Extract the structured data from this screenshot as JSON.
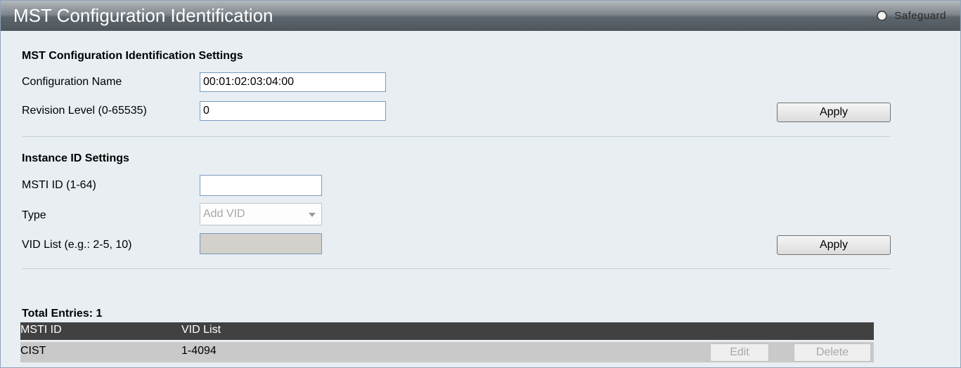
{
  "header": {
    "title": "MST Configuration Identification",
    "safeguard_label": "Safeguard"
  },
  "mst_settings": {
    "section_title": "MST Configuration Identification Settings",
    "config_name_label": "Configuration Name",
    "config_name_value": "00:01:02:03:04:00",
    "revision_label": "Revision Level (0-65535)",
    "revision_value": "0",
    "apply_label": "Apply"
  },
  "instance_settings": {
    "section_title": "Instance ID Settings",
    "msti_label": "MSTI ID (1-64)",
    "msti_value": "",
    "type_label": "Type",
    "type_selected": "Add VID",
    "vid_list_label": "VID List (e.g.: 2-5, 10)",
    "vid_list_value": "",
    "apply_label": "Apply"
  },
  "table": {
    "total_entries": "Total Entries: 1",
    "columns": [
      "MSTI ID",
      "VID List"
    ],
    "rows": [
      {
        "msti_id": "CIST",
        "vid_list": "1-4094",
        "edit_label": "Edit",
        "delete_label": "Delete"
      }
    ]
  }
}
